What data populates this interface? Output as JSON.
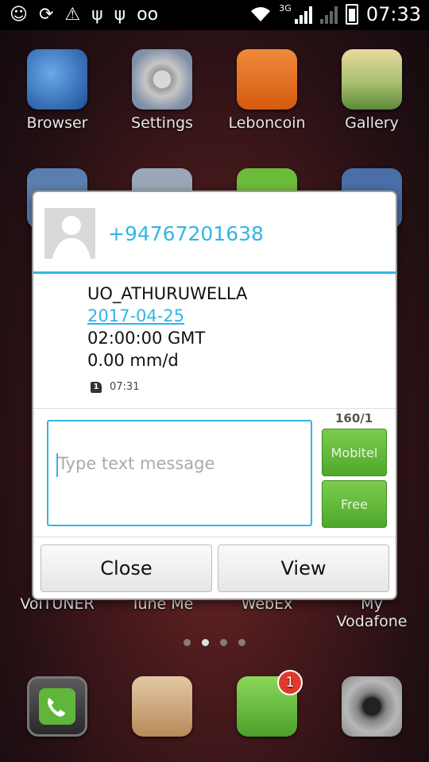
{
  "status_bar": {
    "time": "07:33",
    "network_type": "3G",
    "icons": [
      "smiley-icon",
      "sync-icon",
      "warning-icon",
      "usb-icon",
      "usb-icon",
      "voicemail-icon",
      "wifi-icon",
      "signal-icon",
      "signal-icon",
      "battery-icon"
    ]
  },
  "home_screen": {
    "apps": [
      {
        "label": "Browser",
        "icon": "globe-icon"
      },
      {
        "label": "Settings",
        "icon": "gear-icon"
      },
      {
        "label": "Leboncoin",
        "icon": "box-icon"
      },
      {
        "label": "Gallery",
        "icon": "gallery-icon"
      },
      {
        "label": "VoiTUNER",
        "icon": "app-icon"
      },
      {
        "label": "Tune Me",
        "icon": "app-icon"
      },
      {
        "label": "WebEx",
        "icon": "app-icon"
      },
      {
        "label": "My Vodafone",
        "icon": "app-icon"
      }
    ],
    "dock": [
      {
        "icon": "phone-icon"
      },
      {
        "icon": "contacts-icon"
      },
      {
        "icon": "messaging-icon",
        "badge": "1"
      },
      {
        "icon": "camera-icon"
      }
    ]
  },
  "dialog": {
    "sender": "+94767201638",
    "message_lines": [
      "UO_ATHURUWELLA",
      "2017-04-25",
      "02:00:00 GMT",
      "0.00 mm/d"
    ],
    "sim_label": "1",
    "received_time": "07:31",
    "char_counter": "160/1",
    "input_placeholder": "Type text message",
    "send_buttons": [
      "Mobitel",
      "Free"
    ],
    "close_label": "Close",
    "view_label": "View",
    "accent_color": "#33b5e5",
    "send_color": "#5cb835"
  }
}
